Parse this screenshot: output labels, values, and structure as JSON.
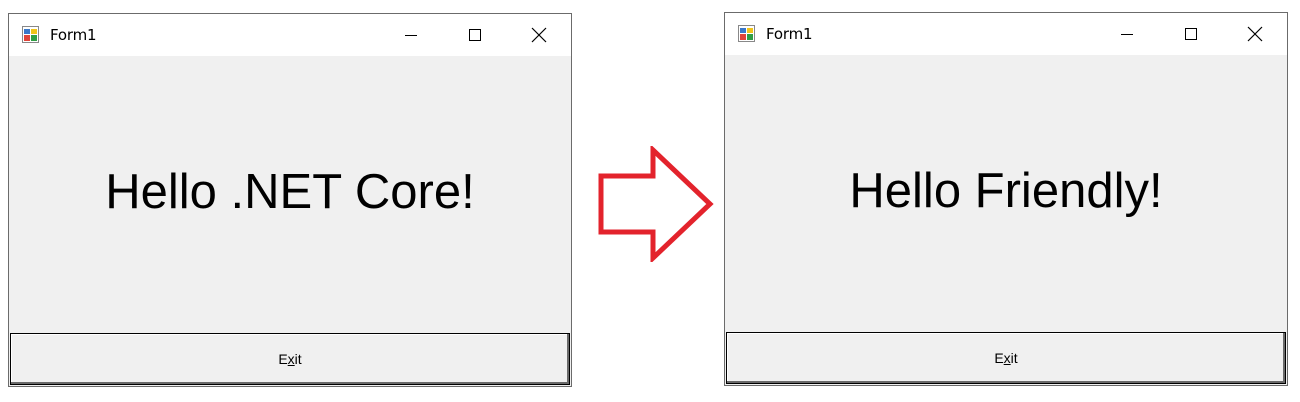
{
  "left_window": {
    "title": "Form1",
    "message": "Hello .NET Core!",
    "exit_button": {
      "label": "Exit",
      "mnemonic_index": 1
    }
  },
  "right_window": {
    "title": "Form1",
    "message": "Hello Friendly!",
    "exit_button": {
      "label": "Exit",
      "mnemonic_index": 1
    }
  },
  "arrow": {
    "icon": "right-arrow-icon",
    "color": "#e3232c"
  },
  "titlebar_buttons": [
    "minimize-icon",
    "maximize-icon",
    "close-icon"
  ]
}
